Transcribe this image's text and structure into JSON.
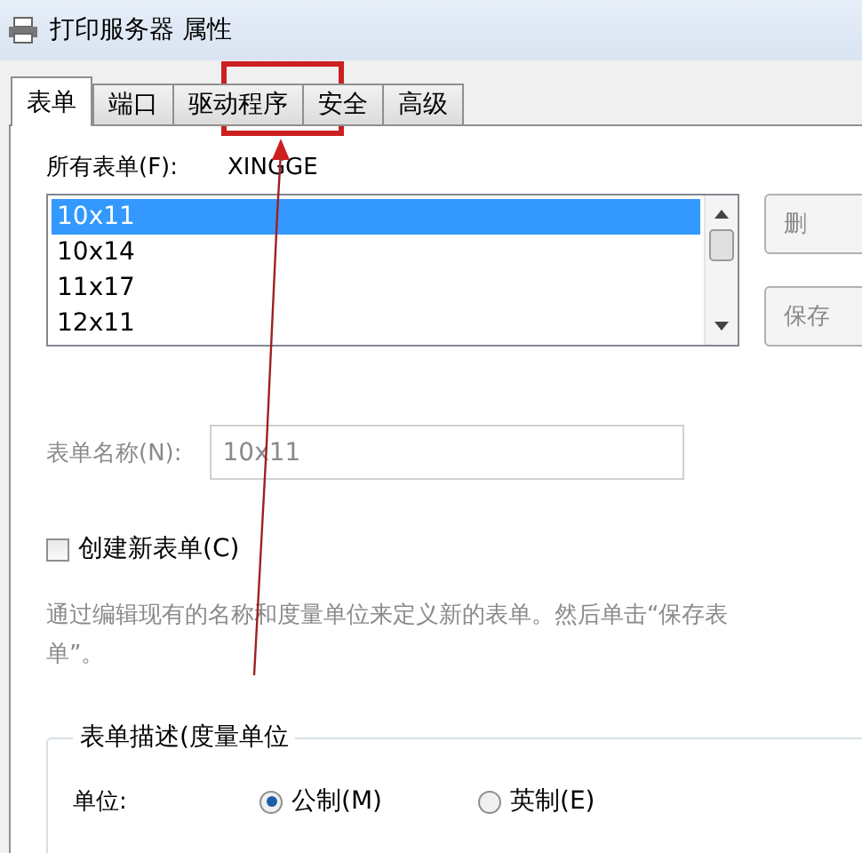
{
  "window": {
    "title": "打印服务器 属性"
  },
  "tabs": [
    {
      "label": "表单",
      "selected": true
    },
    {
      "label": "端口",
      "selected": false
    },
    {
      "label": "驱动程序",
      "selected": false
    },
    {
      "label": "安全",
      "selected": false
    },
    {
      "label": "高级",
      "selected": false
    }
  ],
  "server_label": "所有表单(F):",
  "server_name": "XINGGE",
  "forms_list": [
    {
      "label": "10x11",
      "selected": true
    },
    {
      "label": "10x14",
      "selected": false
    },
    {
      "label": "11x17",
      "selected": false
    },
    {
      "label": "12x11",
      "selected": false
    }
  ],
  "side_buttons": [
    {
      "label": "删",
      "disabled": true
    },
    {
      "label": "保存",
      "disabled": true
    }
  ],
  "form_name": {
    "label": "表单名称(N):",
    "value": "10x11",
    "disabled": true
  },
  "create_new": {
    "label": "创建新表单(C)",
    "checked": false
  },
  "hint": "通过编辑现有的名称和度量单位来定义新的表单。然后单击“保存表单”。",
  "group": {
    "title": "表单描述(度量单位",
    "units_label": "单位:",
    "units": [
      {
        "label": "公制(M)",
        "selected": true
      },
      {
        "label": "英制(E)",
        "selected": false
      }
    ]
  }
}
